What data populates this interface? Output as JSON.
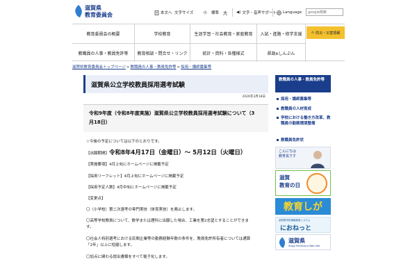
{
  "header": {
    "logo_line1": "滋賀県",
    "logo_line2": "教育委員会",
    "text_only": "本文へ",
    "font_size_label": "文字サイズ",
    "size_small": "小",
    "size_standard": "標準",
    "size_large": "大",
    "speech_support": "文字・音声サポート",
    "language": "Language",
    "search_placeholder": "google検索"
  },
  "nav": {
    "row1": [
      "教育委員会の概要",
      "学校教育",
      "生涯学習・社会教育・家庭教育",
      "入試・進路・修学支援"
    ],
    "row2": [
      "教職員の人事・教員免許等",
      "教育相談・問合せ・リンク",
      "統計・資料・各種様式",
      "県政eしんぶん"
    ],
    "disaster": "防災・災害情報"
  },
  "breadcrumb": [
    "滋賀県教育委員会トップページ",
    "教職員の人事・教員免許等",
    "採用・講師募集等"
  ],
  "main": {
    "title": "滋賀県公立学校教員採用選考試験",
    "date": "2026年3月18日",
    "notice_line1": "令和9年度（令和8年度実施）滋賀県公立学校教員採用選考試験について（3",
    "notice_line2": "月18日）",
    "intro": "☆今後の予定については以下のとおりです。",
    "period_label": "【出願期間】",
    "period_value": "令和8年4月17日（金曜日）～ 5月12日（火曜日）",
    "guidelines": "【実施要項】4月上旬にホームページに掲載予定",
    "leaflet": "【採用リーフレット】4月上旬にホームページに掲載予定",
    "hire_count": "【採用予定人数】4月中旬にホームページに掲載予定",
    "changes_header": "【変更点】",
    "change1": "〇（小学校）第二次選考の専門実技（体育実技）を廃止します。",
    "change2": "〇高等学校教員について、数学または理科に出願した場合、工業を第2志望とすることができま",
    "change2b": "す。",
    "change3": "〇社会人特別選考における民間企業等の勤務経験年数の条件を、教員免許所有者については通算",
    "change3b": "「2年」以上に短縮します。",
    "change4": "〇加点に関わる提出書類をすべて電子化します。"
  },
  "sidebar": {
    "header": "教職員の人事・教員免許等",
    "items": [
      "採用・講師募集等",
      "教職員の人材育成",
      "学校における働き方改革、教職員の勤務環境整備",
      "教職員免許状"
    ]
  },
  "banners": {
    "superintendent": "こんにちは\n教育長です",
    "education_day": "滋賀\n教育の日",
    "kyoiku_shiga": "教育しが",
    "net_caption": "滋賀県学校情報検索システム",
    "net_name": "におねっと",
    "pref_name": "滋賀県",
    "pref_sub": "Shiga Prefecture Web Site"
  },
  "colors": {
    "brand_blue": "#1a3e8c",
    "disaster_yellow": "#f3c12e",
    "title_bg": "#e9eef7"
  }
}
